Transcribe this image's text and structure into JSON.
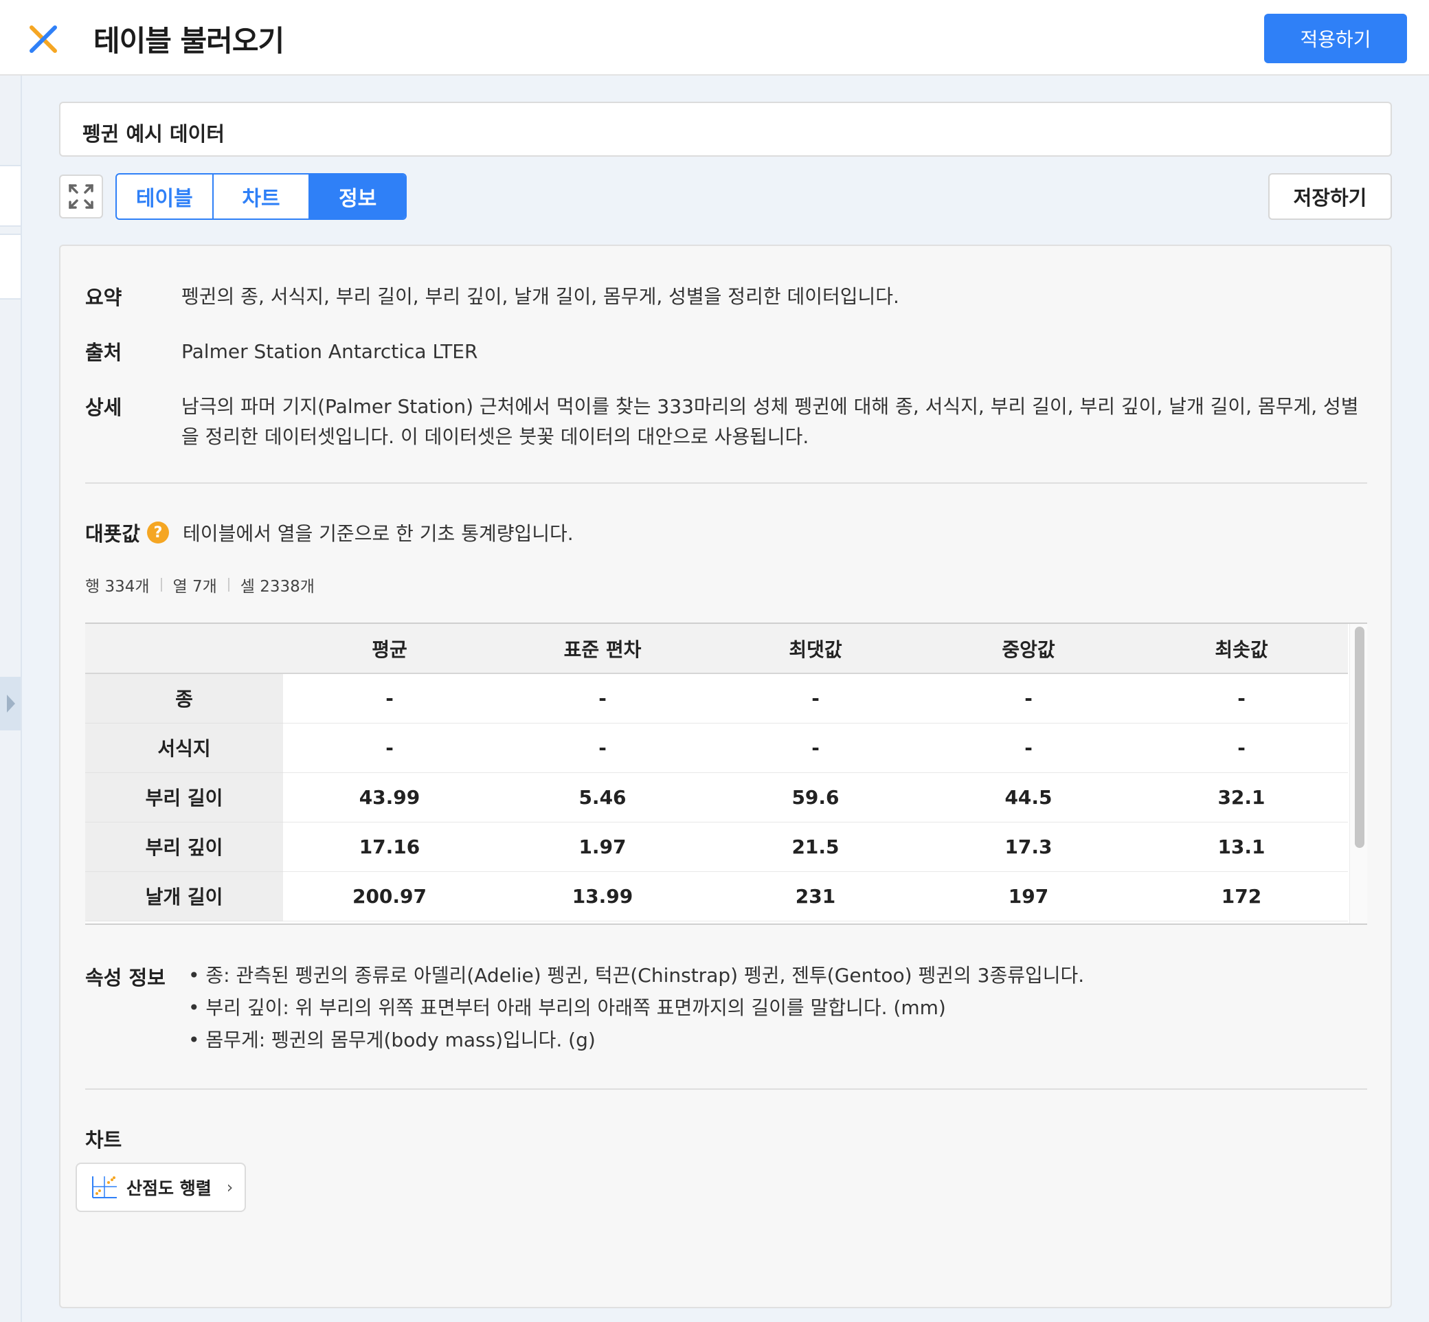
{
  "header": {
    "title": "테이블 불러오기",
    "apply_label": "적용하기"
  },
  "dataset": {
    "name": "펭귄 예시 데이터"
  },
  "toolbar": {
    "tabs": [
      {
        "label": "테이블",
        "active": false
      },
      {
        "label": "차트",
        "active": false
      },
      {
        "label": "정보",
        "active": true
      }
    ],
    "save_label": "저장하기"
  },
  "info": {
    "summary_label": "요약",
    "summary": "펭귄의 종, 서식지, 부리 길이, 부리 깊이, 날개 길이, 몸무게, 성별을 정리한 데이터입니다.",
    "source_label": "출처",
    "source": "Palmer Station Antarctica LTER",
    "detail_label": "상세",
    "detail": "남극의 파머 기지(Palmer Station) 근처에서 먹이를 찾는 333마리의 성체 펭귄에 대해 종, 서식지, 부리 길이, 부리 깊이, 날개 길이, 몸무게, 성별을 정리한 데이터셋입니다. 이 데이터셋은 붓꽃 데이터의 대안으로 사용됩니다."
  },
  "stats": {
    "label": "대푯값",
    "help": "?",
    "description": "테이블에서 열을 기준으로 한 기초 통계량입니다.",
    "rows": "행 334개",
    "cols": "열 7개",
    "cells": "셀 2338개",
    "columns": [
      "평균",
      "표준 편차",
      "최댓값",
      "중앙값",
      "최솟값"
    ],
    "table": [
      {
        "name": "종",
        "values": [
          "-",
          "-",
          "-",
          "-",
          "-"
        ]
      },
      {
        "name": "서식지",
        "values": [
          "-",
          "-",
          "-",
          "-",
          "-"
        ]
      },
      {
        "name": "부리 길이",
        "values": [
          "43.99",
          "5.46",
          "59.6",
          "44.5",
          "32.1"
        ]
      },
      {
        "name": "부리 깊이",
        "values": [
          "17.16",
          "1.97",
          "21.5",
          "17.3",
          "13.1"
        ]
      },
      {
        "name": "날개 길이",
        "values": [
          "200.97",
          "13.99",
          "231",
          "197",
          "172"
        ]
      }
    ]
  },
  "attributes": {
    "label": "속성 정보",
    "items": [
      "종: 관측된 펭귄의 종류로 아델리(Adelie) 펭귄, 턱끈(Chinstrap) 펭귄, 젠투(Gentoo) 펭귄의 3종류입니다.",
      "부리 깊이: 위 부리의 위쪽 표면부터 아래 부리의 아래쪽 표면까지의 길이를 말합니다. (mm)",
      "몸무게: 펭귄의 몸무게(body mass)입니다. (g)"
    ]
  },
  "charts": {
    "label": "차트",
    "items": [
      {
        "label": "산점도 행렬",
        "icon": "scatter-matrix-icon"
      }
    ]
  },
  "colors": {
    "accent": "#2f80f7",
    "help": "#f5a623",
    "close_orange": "#f5a623",
    "close_blue": "#2f80f7"
  }
}
